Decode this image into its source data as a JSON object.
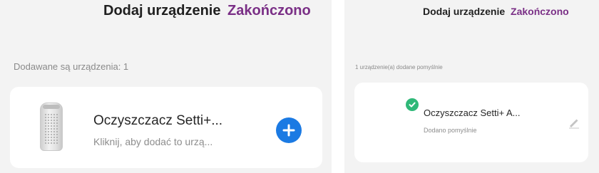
{
  "left_panel": {
    "header": {
      "title": "Dodaj urządzenie",
      "done_label": "Zakończono"
    },
    "status": "Dodawane są urządzenia: 1",
    "device": {
      "name": "Oczyszczacz Setti+...",
      "subtitle": "Kliknij, aby dodać to urzą...",
      "image_icon": "air-purifier-image",
      "action_icon": "plus-icon"
    }
  },
  "right_panel": {
    "header": {
      "title": "Dodaj urządzenie",
      "done_label": "Zakończono"
    },
    "status": "1 urządzenie(a) dodane pomyślnie",
    "device": {
      "name": "Oczyszczacz Setti+ A...",
      "subtitle": "Dodano pomyślnie",
      "status_icon": "check-icon",
      "action_icon": "pencil-icon"
    }
  },
  "colors": {
    "accent_purple": "#7a2f86",
    "add_button_blue": "#1b7ae3",
    "success_green": "#2fb878",
    "background": "#f3f3f3",
    "card": "#ffffff"
  }
}
